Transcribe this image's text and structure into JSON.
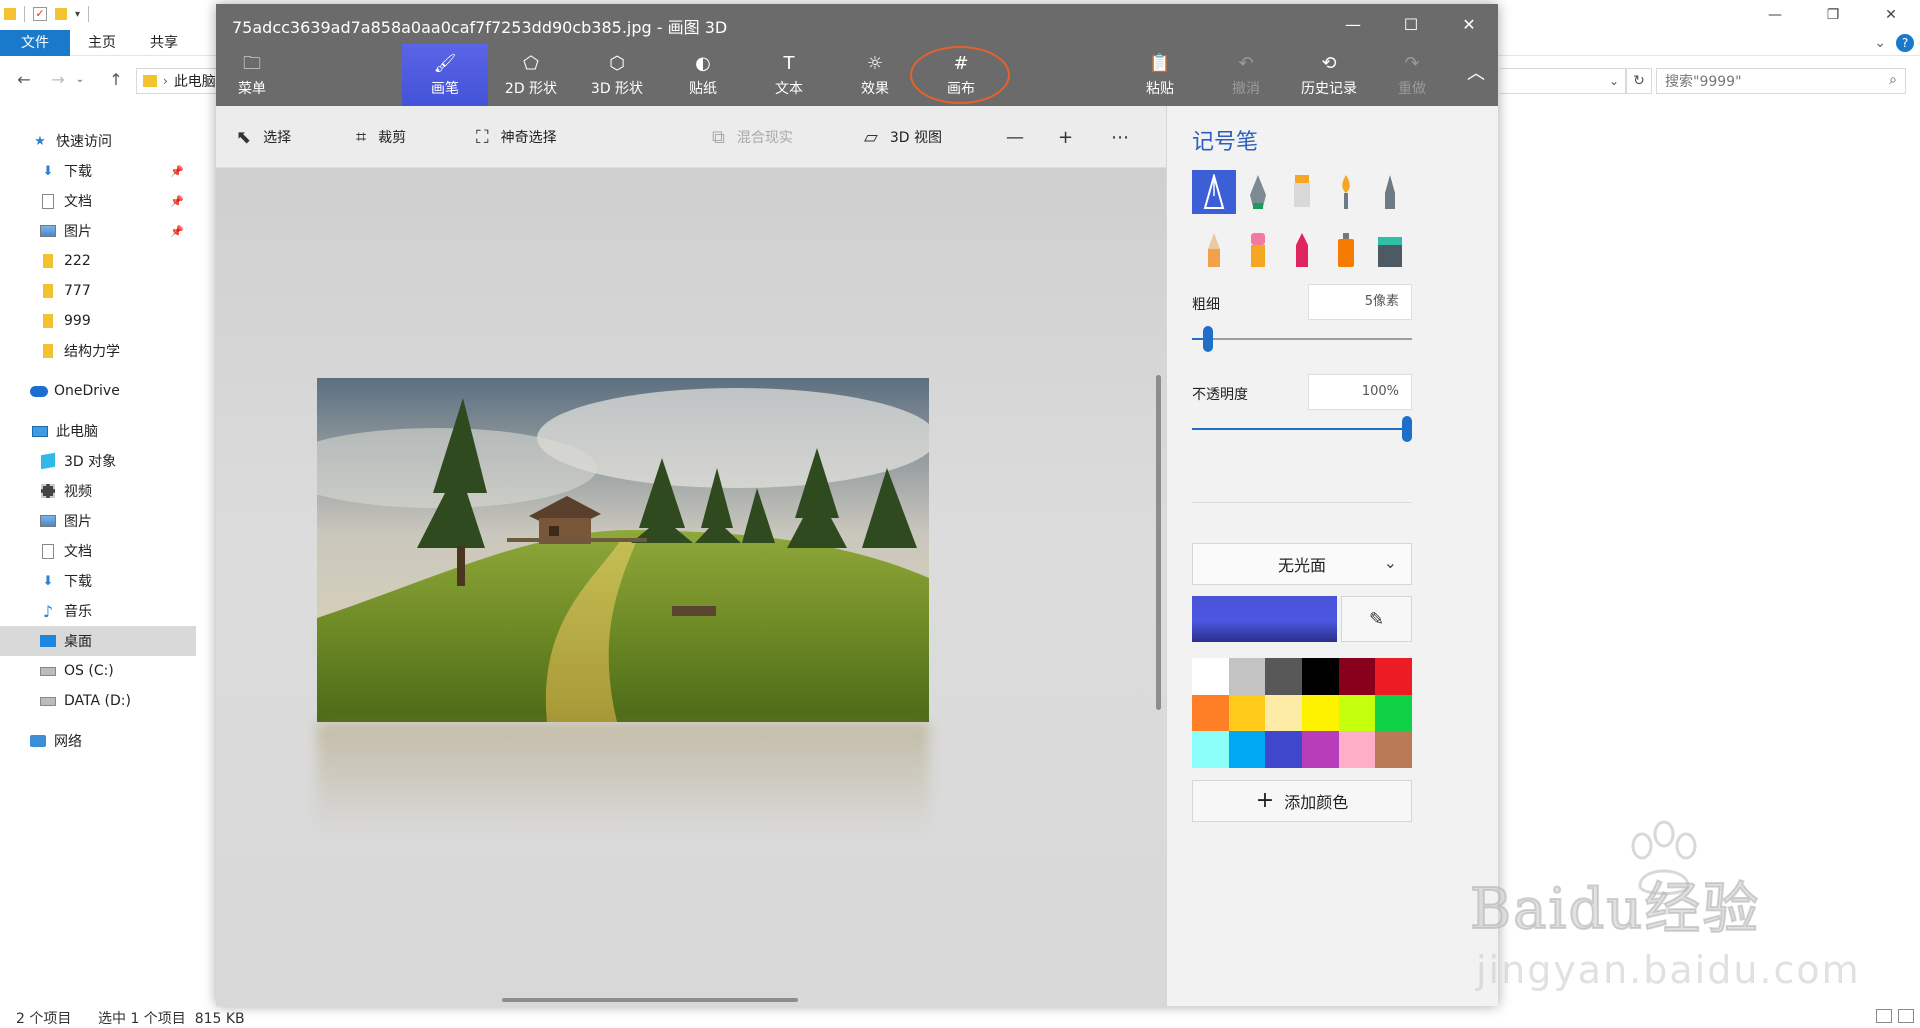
{
  "explorer": {
    "ribbon_tabs": [
      "文件",
      "主页",
      "共享"
    ],
    "address_crumb": "此电脑",
    "search_placeholder": "搜索\"9999\"",
    "nav_quick_access": "快速访问",
    "nav_items": [
      {
        "label": "下载",
        "pinned": true,
        "icon": "download-icon"
      },
      {
        "label": "文档",
        "pinned": true,
        "icon": "document-icon"
      },
      {
        "label": "图片",
        "pinned": true,
        "icon": "pictures-icon"
      },
      {
        "label": "222",
        "icon": "folder-icon"
      },
      {
        "label": "777",
        "icon": "folder-icon"
      },
      {
        "label": "999",
        "icon": "folder-icon"
      },
      {
        "label": "结构力学",
        "icon": "folder-icon"
      }
    ],
    "nav_onedrive": "OneDrive",
    "nav_this_pc": "此电脑",
    "pc_items": [
      {
        "label": "3D 对象",
        "icon": "3d-objects-icon"
      },
      {
        "label": "视频",
        "icon": "video-icon"
      },
      {
        "label": "图片",
        "icon": "pictures-icon"
      },
      {
        "label": "文档",
        "icon": "document-icon"
      },
      {
        "label": "下载",
        "icon": "download-icon"
      },
      {
        "label": "音乐",
        "icon": "music-icon"
      },
      {
        "label": "桌面",
        "icon": "desktop-icon",
        "selected": true
      },
      {
        "label": "OS (C:)",
        "icon": "drive-icon"
      },
      {
        "label": "DATA (D:)",
        "icon": "drive-icon"
      }
    ],
    "nav_network": "网络",
    "status": {
      "item_count": "2 个项目",
      "selection": "选中 1 个项目  815 KB"
    }
  },
  "paint3d": {
    "title": "75adcc3639ad7a858a0aa0caf7f7253dd90cb385.jpg - 画图 3D",
    "toolbar": {
      "menu": "菜单",
      "brushes": "画笔",
      "shapes_2d": "2D 形状",
      "shapes_3d": "3D 形状",
      "stickers": "贴纸",
      "text": "文本",
      "effects": "效果",
      "canvas": "画布",
      "paste": "粘贴",
      "undo": "撤消",
      "history": "历史记录",
      "redo": "重做"
    },
    "subbar": {
      "select": "选择",
      "crop": "裁剪",
      "magic_select": "神奇选择",
      "mixed_reality": "混合现实",
      "view_3d": "3D 视图"
    },
    "panel": {
      "title": "记号笔",
      "thickness_label": "粗细",
      "thickness_value": "5像素",
      "thickness": 0.05,
      "opacity_label": "不透明度",
      "opacity_value": "100%",
      "opacity": 1.0,
      "finish": "无光面",
      "add_color": "添加颜色",
      "current_color": "#4a52d8",
      "palette": [
        "#ffffff",
        "#c3c3c3",
        "#585858",
        "#000000",
        "#88001b",
        "#ec1c24",
        "#ff7f27",
        "#ffca18",
        "#fdeca6",
        "#fff200",
        "#c4ff0e",
        "#0ed145",
        "#8cfffb",
        "#00a8f3",
        "#3f48cc",
        "#b83dba",
        "#ffaec8",
        "#b97a56"
      ]
    }
  },
  "watermark": {
    "brand": "Baidu经验",
    "url": "jingyan.baidu.com"
  }
}
